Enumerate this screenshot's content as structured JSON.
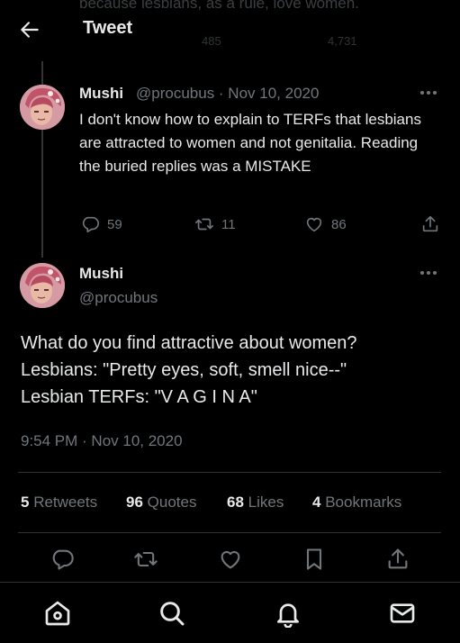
{
  "header": {
    "title": "Tweet",
    "back_icon": "arrow-left-icon",
    "scrolled_previous_text": "because lesbians, as a rule, love women.",
    "scrolled_previous_retweets": "485",
    "scrolled_previous_likes": "4,731"
  },
  "reply_tweet": {
    "display_name": "Mushi",
    "handle_date": "@procubus · Nov 10, 2020",
    "text": "I don't know how to explain to TERFs that lesbians are attracted to women and not genitalia. Reading the buried replies was a MISTAKE",
    "replies": "59",
    "retweets": "11",
    "likes": "86"
  },
  "main_tweet": {
    "display_name": "Mushi",
    "handle": "@procubus",
    "lines": [
      "What do you find attractive about women?",
      "Lesbians: \"Pretty eyes, soft, smell nice--\"",
      "Lesbian TERFs: \"V A G I N A\""
    ],
    "timestamp": "9:54 PM · Nov 10, 2020"
  },
  "stats": {
    "retweets_count": "5",
    "retweets_label": "Retweets",
    "quotes_count": "96",
    "quotes_label": "Quotes",
    "likes_count": "68",
    "likes_label": "Likes",
    "bookmarks_count": "4",
    "bookmarks_label": "Bookmarks"
  },
  "action_bar": [
    "reply-icon",
    "retweet-icon",
    "like-icon",
    "bookmark-icon",
    "share-icon"
  ],
  "bottom_nav": [
    "home-icon",
    "search-icon",
    "notifications-icon",
    "messages-icon"
  ],
  "colors": {
    "background": "#000000",
    "text": "#e7e9ea",
    "muted": "#71767b",
    "divider": "#2f3336",
    "avatar_bg": "#d59aa3"
  }
}
